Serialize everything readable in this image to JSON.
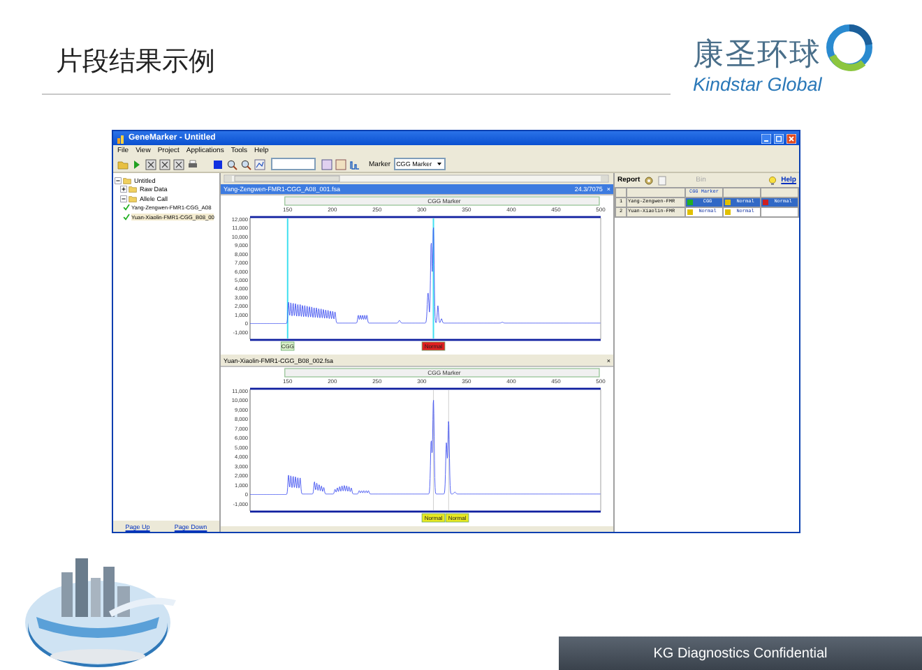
{
  "slide": {
    "title": "片段结果示例",
    "logo_cn": "康圣环球",
    "logo_en": "Kindstar Global",
    "footer": "KG Diagnostics Confidential"
  },
  "app": {
    "title": "GeneMarker - Untitled",
    "menu": [
      "File",
      "View",
      "Project",
      "Applications",
      "Tools",
      "Help"
    ],
    "toolbar": {
      "marker_label": "Marker",
      "marker_value": "CGG Marker"
    },
    "tree": [
      {
        "label": "Untitled",
        "expanded": true,
        "selected": false,
        "children": [
          {
            "label": "Raw Data",
            "expanded": false,
            "selected": false
          },
          {
            "label": "Allele Call",
            "expanded": true,
            "selected": false,
            "children": [
              {
                "label": "Yang-Zengwen-FMR1-CGG_A08",
                "checked": true,
                "selected": false
              },
              {
                "label": "Yuan-Xiaolin-FMR1-CGG_B08_00",
                "checked": true,
                "selected": true
              }
            ]
          }
        ]
      }
    ],
    "page_buttons": [
      "Page Up",
      "Page Down"
    ],
    "charts": [
      {
        "file": "Yang-Zengwen-FMR1-CGG_A08_001.fsa",
        "selected": true,
        "info": "24.3/7075",
        "close": "×",
        "marker": "CGG Marker",
        "x_ticks": [
          "150",
          "200",
          "250",
          "300",
          "350",
          "400",
          "450",
          "500"
        ],
        "y_ticks": [
          "12,000",
          "11,000",
          "10,000",
          "9,000",
          "8,000",
          "7,000",
          "6,000",
          "5,000",
          "4,000",
          "3,000",
          "2,000",
          "1,000",
          "0",
          "-1,000"
        ],
        "alleles": [
          {
            "text": "CGG",
            "color": "#d8f0c8"
          },
          {
            "text": "Normal",
            "color": "#e02020"
          }
        ]
      },
      {
        "file": "Yuan-Xiaolin-FMR1-CGG_B08_002.fsa",
        "selected": false,
        "close": "×",
        "marker": "CGG Marker",
        "x_ticks": [
          "150",
          "200",
          "250",
          "300",
          "350",
          "400",
          "450",
          "500"
        ],
        "y_ticks": [
          "11,000",
          "10,000",
          "9,000",
          "8,000",
          "7,000",
          "6,000",
          "5,000",
          "4,000",
          "3,000",
          "2,000",
          "1,000",
          "0",
          "-1,000"
        ],
        "alleles": [
          {
            "text": "Normal",
            "color": "#e8e820"
          },
          {
            "text": "Normal",
            "color": "#e8e820"
          }
        ]
      }
    ],
    "report": {
      "label": "Report",
      "bin": {
        "label": "Bin",
        "disabled": true
      },
      "help": "Help",
      "header": "CGG Marker",
      "rows": [
        {
          "num": "1",
          "sample": "Yang-Zengwen-FMR",
          "selected": true,
          "calls": [
            {
              "text": "CGG",
              "color": "#20b020"
            },
            {
              "text": "Normal",
              "color": "#e0c000"
            },
            {
              "text": "Normal",
              "color": "#d02020"
            }
          ]
        },
        {
          "num": "2",
          "sample": "Yuan-Xiaolin-FMR",
          "selected": false,
          "calls": [
            {
              "text": "Normal",
              "color": "#e0c000"
            },
            {
              "text": "Normal",
              "color": "#e0c000"
            }
          ]
        }
      ]
    }
  }
}
